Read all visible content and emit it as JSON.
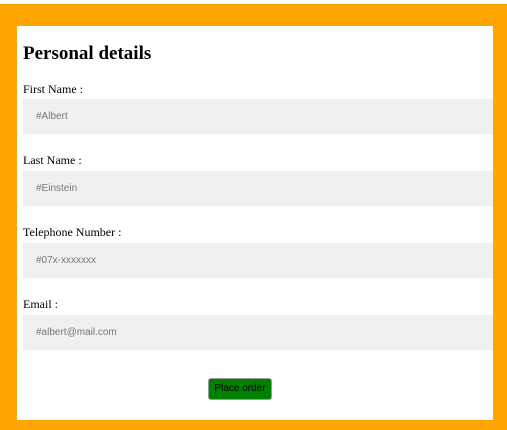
{
  "colors": {
    "border": "#FFA500",
    "card_background": "#FFFFFF",
    "input_background": "#F0F0F0",
    "button_background": "#008000"
  },
  "form": {
    "title": "Personal details",
    "fields": [
      {
        "label": "First Name :",
        "placeholder": "#Albert",
        "value": ""
      },
      {
        "label": "Last Name :",
        "placeholder": "#Einstein",
        "value": ""
      },
      {
        "label": "Telephone Number :",
        "placeholder": "#07x-xxxxxxx",
        "value": ""
      },
      {
        "label": "Email :",
        "placeholder": "#albert@mail.com",
        "value": ""
      }
    ],
    "submit_label": "Place order"
  }
}
